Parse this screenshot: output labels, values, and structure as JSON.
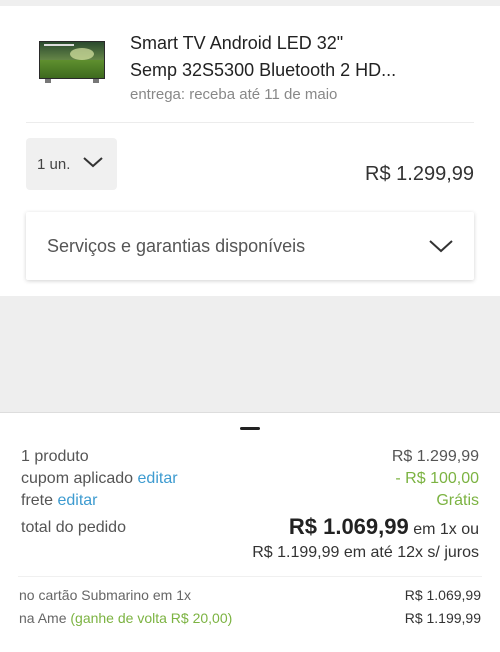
{
  "product": {
    "title_line1": "Smart TV Android LED 32\"",
    "title_line2": "Semp 32S5300 Bluetooth 2 HD...",
    "delivery": "entrega: receba até 11 de maio",
    "image_icon": "tv-thumbnail-icon",
    "quantity_label": "1 un.",
    "unit_price": "R$ 1.299,99"
  },
  "services": {
    "label": "Serviços e garantias disponíveis"
  },
  "summary": {
    "products_label": "1 produto",
    "products_value": "R$ 1.299,99",
    "coupon_label": "cupom aplicado",
    "coupon_edit": "editar",
    "coupon_value": "- R$ 100,00",
    "shipping_label": "frete",
    "shipping_edit": "editar",
    "shipping_value": "Grátis",
    "total_label": "total do pedido",
    "total_value": "R$ 1.069,99",
    "total_suffix": "em 1x ou",
    "installments": "R$ 1.199,99 em até 12x s/ juros"
  },
  "payment": {
    "card_label": "no cartão Submarino em 1x",
    "card_value": "R$ 1.069,99",
    "ame_label": "na Ame",
    "ame_cashback": "(ganhe de volta R$ 20,00)",
    "ame_value": "R$ 1.199,99"
  },
  "colors": {
    "link": "#3d9bd0",
    "discount": "#7cb342"
  }
}
